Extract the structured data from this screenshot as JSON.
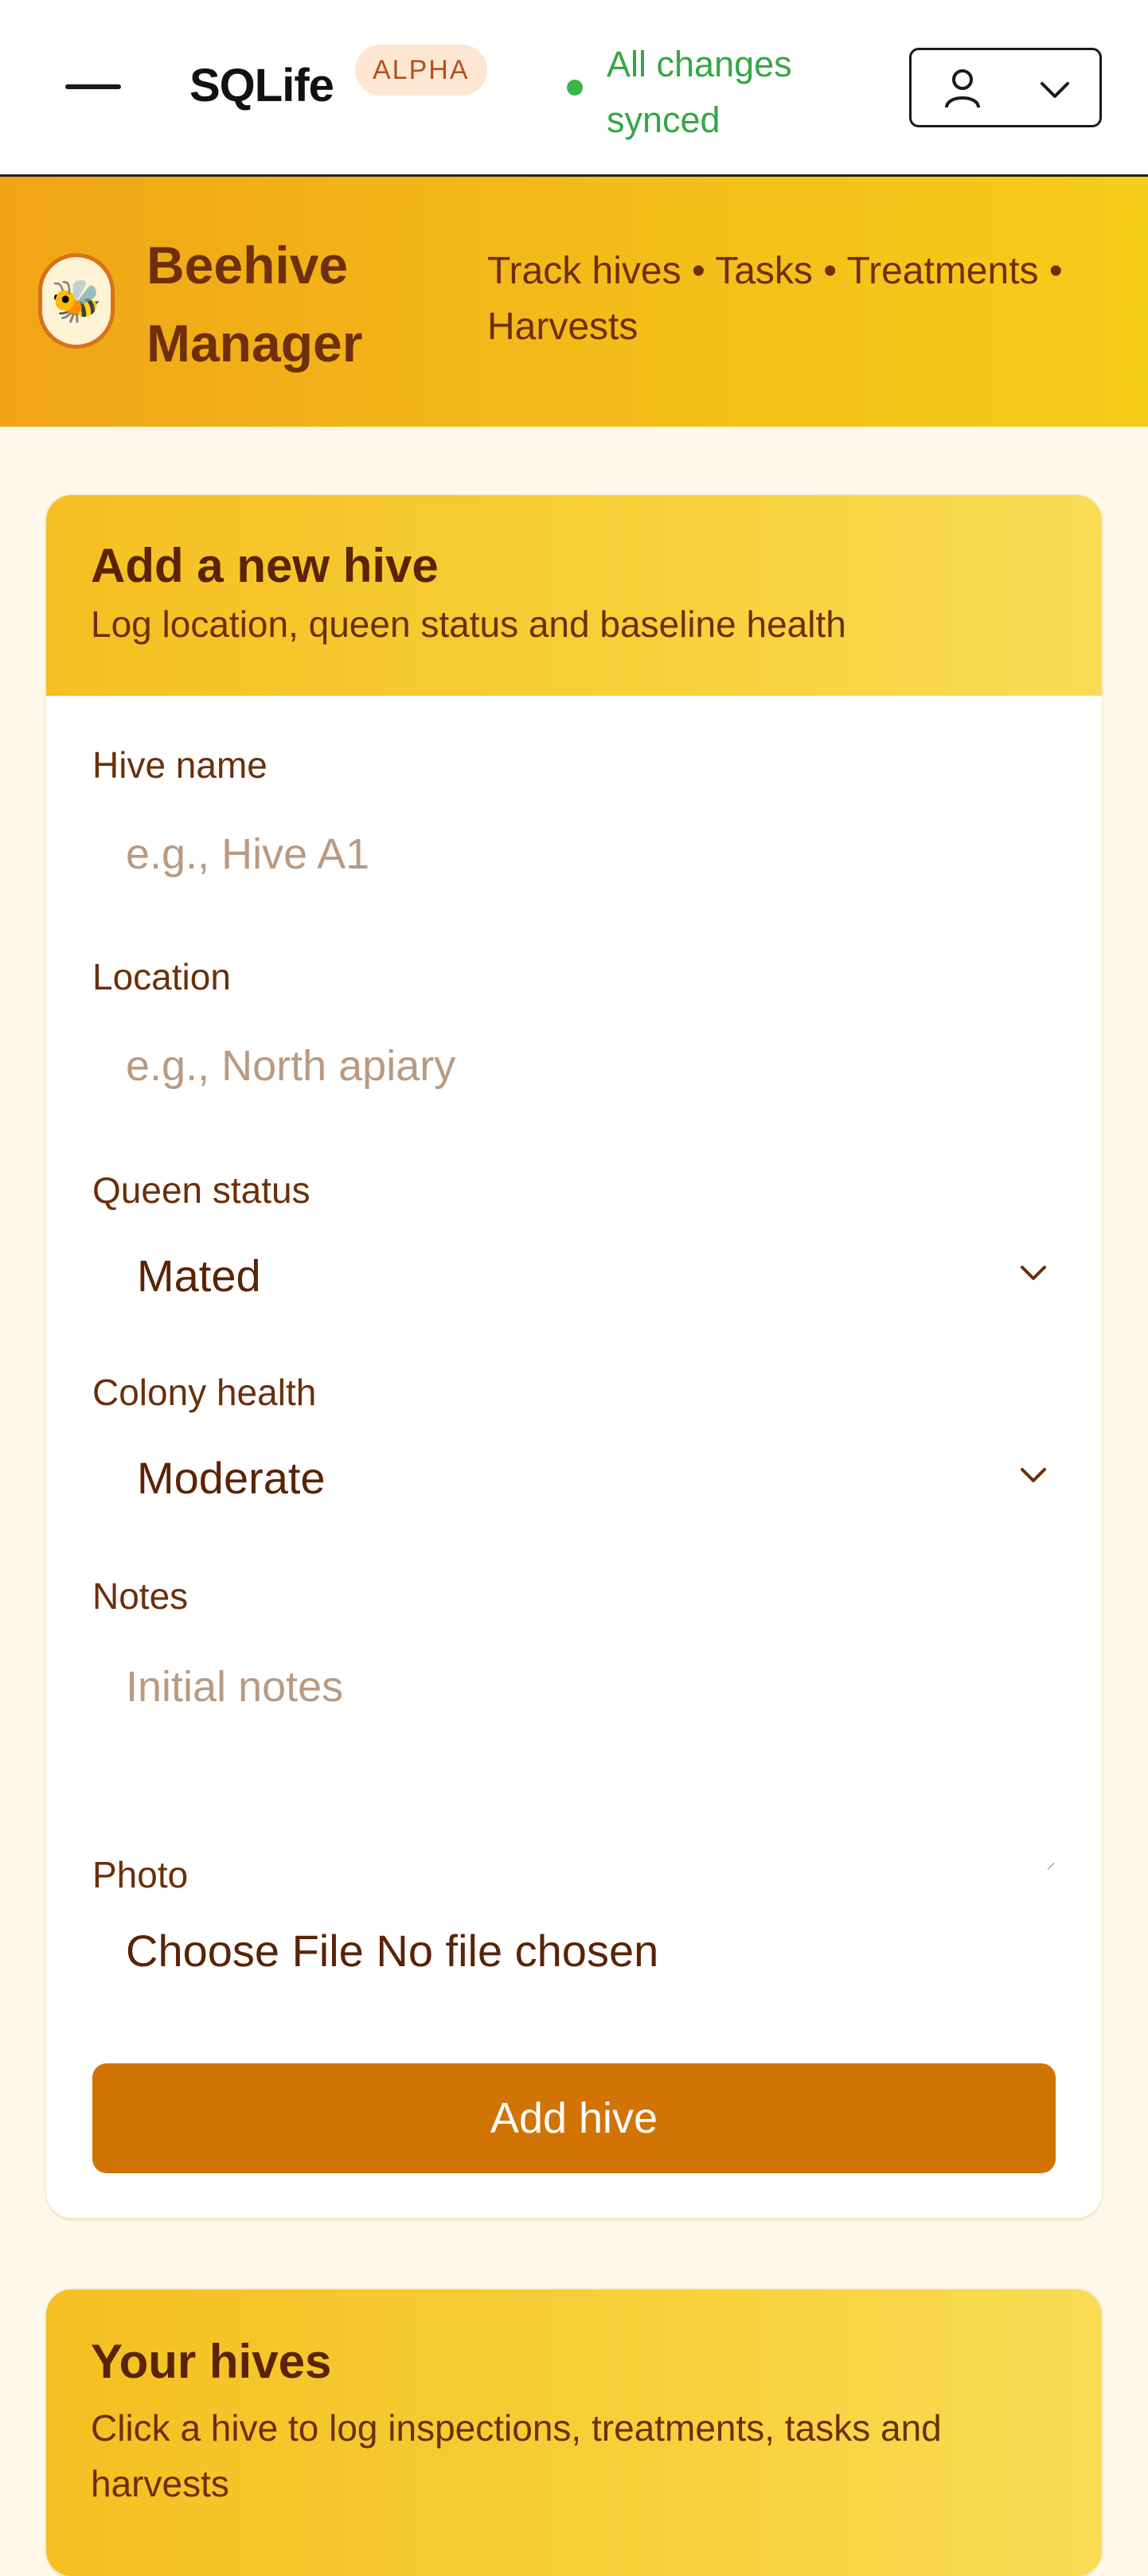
{
  "topbar": {
    "brand": "SQLife",
    "badge": "ALPHA",
    "sync_status": "All changes synced"
  },
  "hero": {
    "title": "Beehive Manager",
    "nav": [
      "Track hives",
      "Tasks",
      "Treatments",
      "Harvests"
    ],
    "separator": "•"
  },
  "add_hive": {
    "title": "Add a new hive",
    "subtitle": "Log location, queen status and baseline health",
    "name_label": "Hive name",
    "name_placeholder": "e.g., Hive A1",
    "location_label": "Location",
    "location_placeholder": "e.g., North apiary",
    "queen_label": "Queen status",
    "queen_value": "Mated",
    "health_label": "Colony health",
    "health_value": "Moderate",
    "notes_label": "Notes",
    "notes_placeholder": "Initial notes",
    "photo_label": "Photo",
    "file_button": "Choose File",
    "file_status": "No file chosen",
    "submit_label": "Add hive"
  },
  "your_hives": {
    "title": "Your hives",
    "subtitle": "Click a hive to log inspections, treatments, tasks and harvests"
  },
  "colors": {
    "accent": "#d17305",
    "banner": "#f3b91a",
    "sync": "#34a746"
  }
}
